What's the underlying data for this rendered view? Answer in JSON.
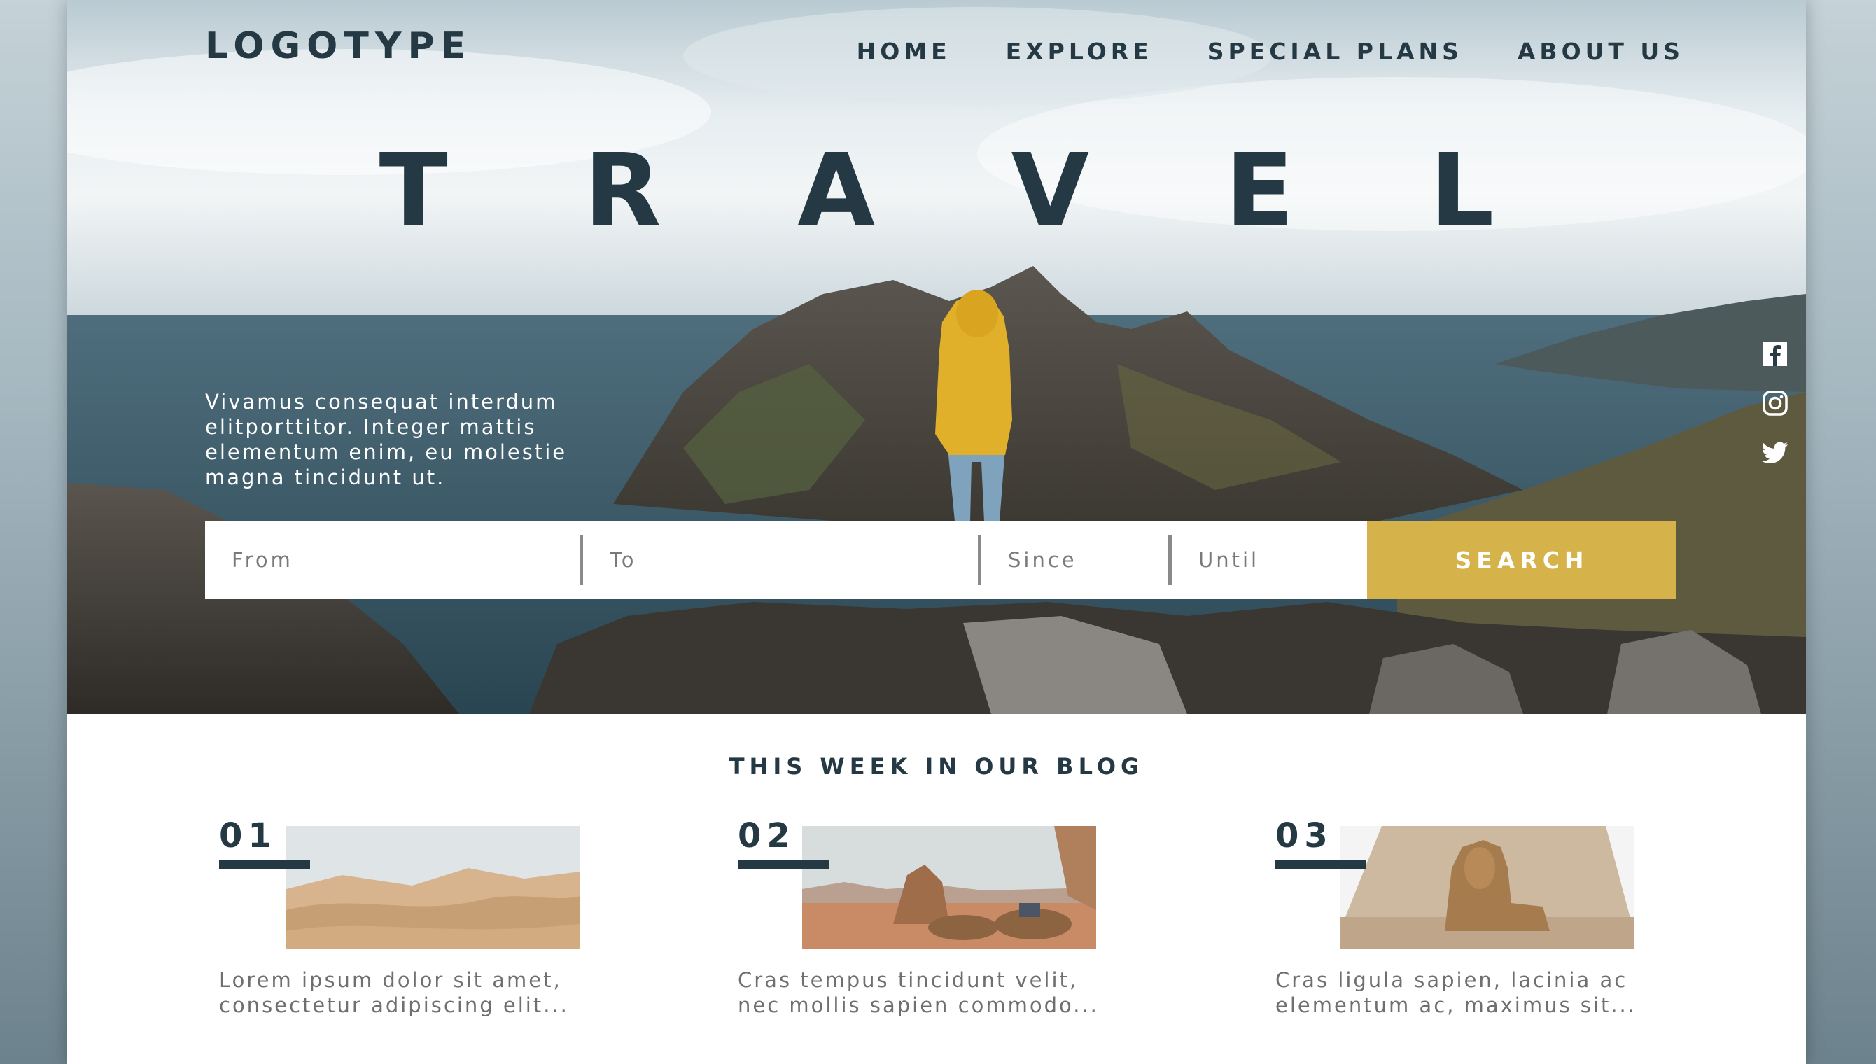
{
  "header": {
    "logo": "LOGOTYPE",
    "nav": [
      {
        "label": "HOME"
      },
      {
        "label": "EXPLORE"
      },
      {
        "label": "SPECIAL PLANS"
      },
      {
        "label": "ABOUT US"
      }
    ]
  },
  "hero": {
    "title": "T R A V E L",
    "tagline": "Vivamus consequat interdum elitporttitor. Integer mattis elementum enim, eu molestie magna tincidunt ut."
  },
  "social": [
    "facebook-icon",
    "instagram-icon",
    "twitter-icon"
  ],
  "search": {
    "from_placeholder": "From",
    "to_placeholder": "To",
    "since_placeholder": "Since",
    "until_placeholder": "Until",
    "button_label": "SEARCH"
  },
  "blog": {
    "title": "THIS WEEK IN OUR BLOG",
    "posts": [
      {
        "number": "01",
        "excerpt": "Lorem ipsum dolor sit amet, consectetur adipiscing elit..."
      },
      {
        "number": "02",
        "excerpt": "Cras tempus tincidunt velit, nec mollis sapien commodo..."
      },
      {
        "number": "03",
        "excerpt": "Cras ligula sapien, lacinia ac elementum ac, maximus sit..."
      }
    ]
  },
  "colors": {
    "primary_dark": "#243943",
    "accent": "#d6b34a",
    "text_muted": "#6f6f6f"
  }
}
